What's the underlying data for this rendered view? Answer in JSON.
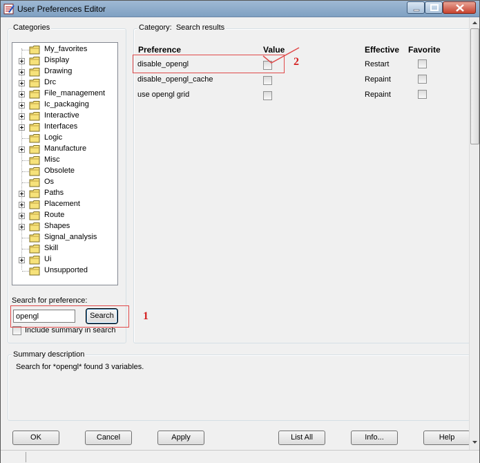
{
  "window": {
    "title": "User Preferences Editor"
  },
  "categories": {
    "label": "Categories",
    "items": [
      {
        "label": "My_favorites",
        "expandable": false
      },
      {
        "label": "Display",
        "expandable": true
      },
      {
        "label": "Drawing",
        "expandable": true
      },
      {
        "label": "Drc",
        "expandable": true
      },
      {
        "label": "File_management",
        "expandable": true
      },
      {
        "label": "Ic_packaging",
        "expandable": true
      },
      {
        "label": "Interactive",
        "expandable": true
      },
      {
        "label": "Interfaces",
        "expandable": true
      },
      {
        "label": "Logic",
        "expandable": false
      },
      {
        "label": "Manufacture",
        "expandable": true
      },
      {
        "label": "Misc",
        "expandable": false
      },
      {
        "label": "Obsolete",
        "expandable": false
      },
      {
        "label": "Os",
        "expandable": false
      },
      {
        "label": "Paths",
        "expandable": true
      },
      {
        "label": "Placement",
        "expandable": true
      },
      {
        "label": "Route",
        "expandable": true
      },
      {
        "label": "Shapes",
        "expandable": true
      },
      {
        "label": "Signal_analysis",
        "expandable": false
      },
      {
        "label": "Skill",
        "expandable": false
      },
      {
        "label": "Ui",
        "expandable": true
      },
      {
        "label": "Unsupported",
        "expandable": false
      }
    ]
  },
  "search": {
    "label": "Search for preference:",
    "value": "opengl",
    "button": "Search",
    "include_summary_label": "Include summary in search",
    "include_summary_checked": false
  },
  "results": {
    "category_label": "Category:",
    "category_value": "Search results",
    "headers": {
      "preference": "Preference",
      "value": "Value",
      "effective": "Effective",
      "favorite": "Favorite"
    },
    "rows": [
      {
        "preference": "disable_opengl",
        "value": false,
        "effective": "Restart",
        "favorite": false
      },
      {
        "preference": "disable_opengl_cache",
        "value": false,
        "effective": "Repaint",
        "favorite": false
      },
      {
        "preference": "use opengl grid",
        "value": false,
        "effective": "Repaint",
        "favorite": false
      }
    ]
  },
  "summary": {
    "label": "Summary description",
    "text": "Search for *opengl* found 3 variables."
  },
  "buttons": {
    "ok": "OK",
    "cancel": "Cancel",
    "apply": "Apply",
    "list_all": "List All",
    "info": "Info...",
    "help": "Help"
  },
  "annotations": {
    "label_1": "1",
    "label_2": "2",
    "color": "#e04848"
  }
}
